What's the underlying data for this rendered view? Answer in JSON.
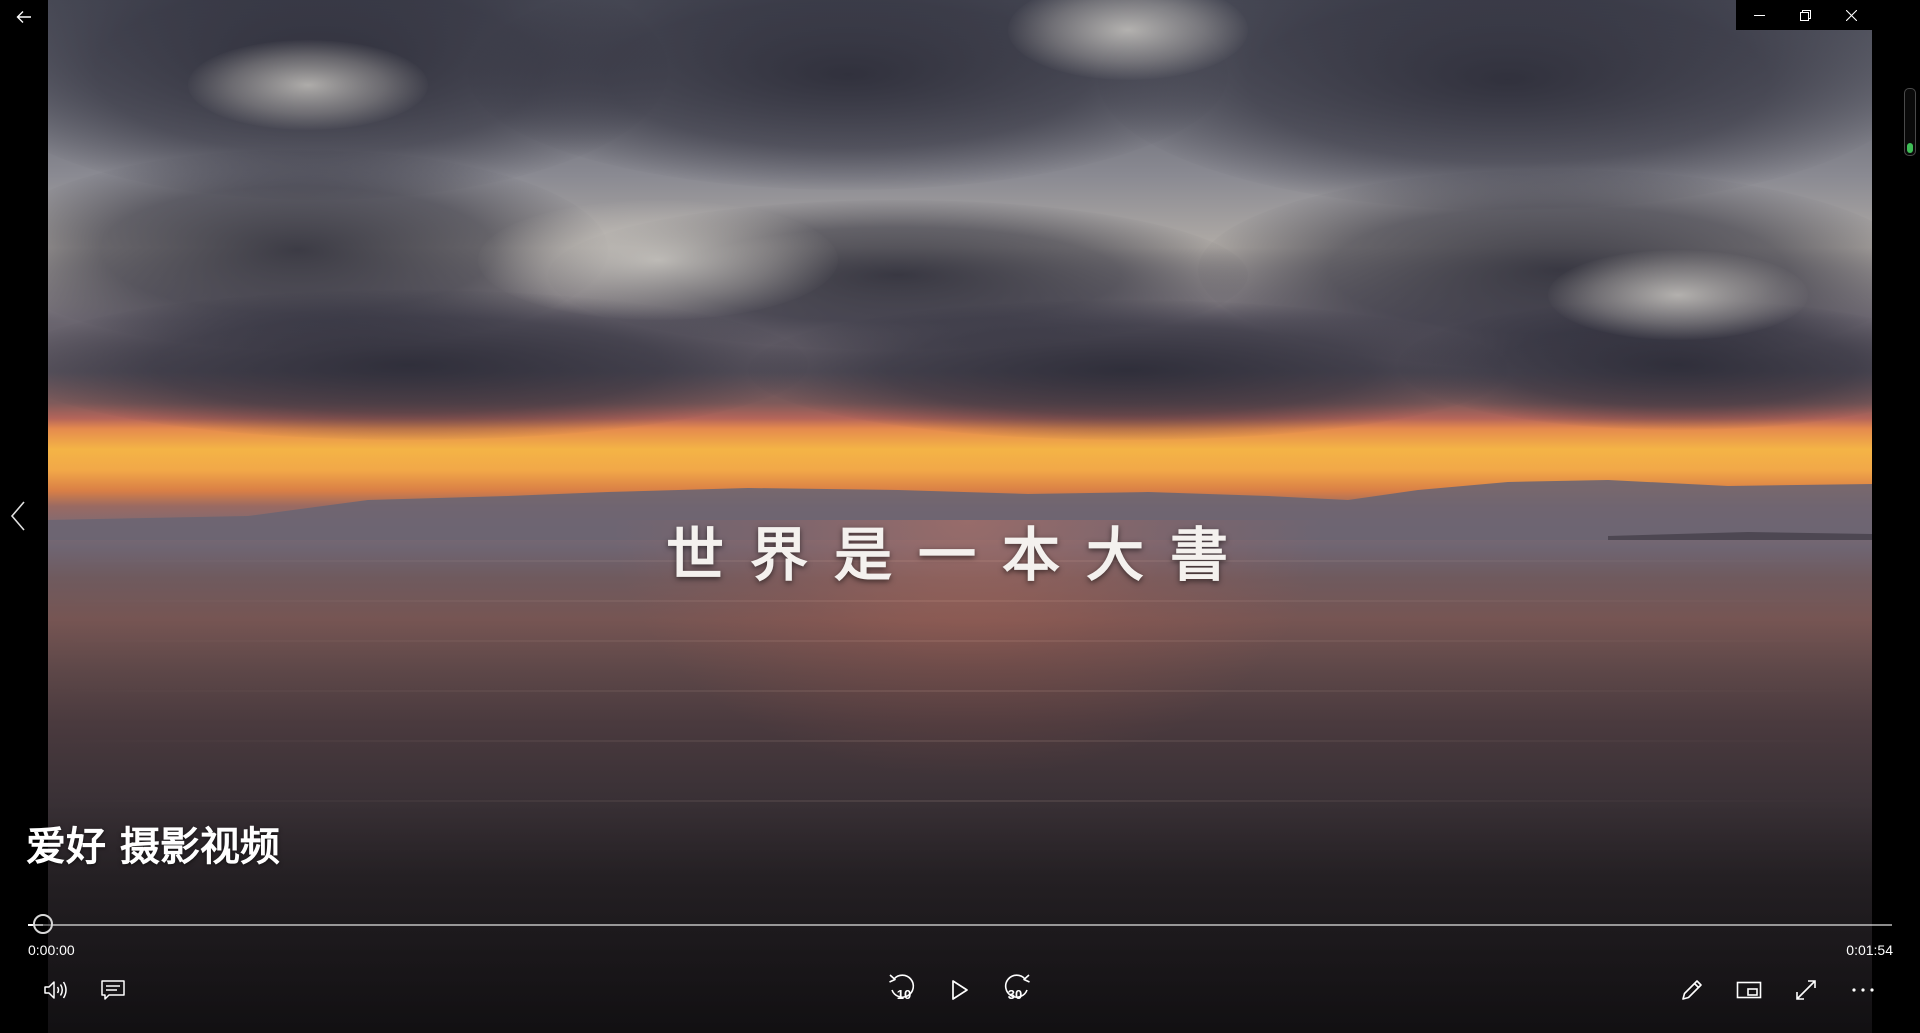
{
  "window": {
    "back_icon": "arrow-left-icon",
    "minimize_icon": "minimize-icon",
    "restore_icon": "restore-icon",
    "close_icon": "close-icon"
  },
  "video": {
    "caption": "世界是一本大書",
    "title": "爱好 摄影视频"
  },
  "player": {
    "current_time": "0:00:00",
    "total_time": "0:01:54",
    "progress_fraction": 0.008,
    "volume_level_fraction": 0.15,
    "skip_back_label": "10",
    "skip_forward_label": "30",
    "accent_color": "#3fbf57"
  },
  "controls": {
    "left": [
      "volume-icon",
      "subtitles-icon"
    ],
    "center": [
      "rewind-10-icon",
      "play-icon",
      "forward-30-icon"
    ],
    "right": [
      "pencil-icon",
      "miniview-icon",
      "fullscreen-icon",
      "more-icon"
    ]
  },
  "navigation": {
    "previous_icon": "chevron-left-icon"
  }
}
